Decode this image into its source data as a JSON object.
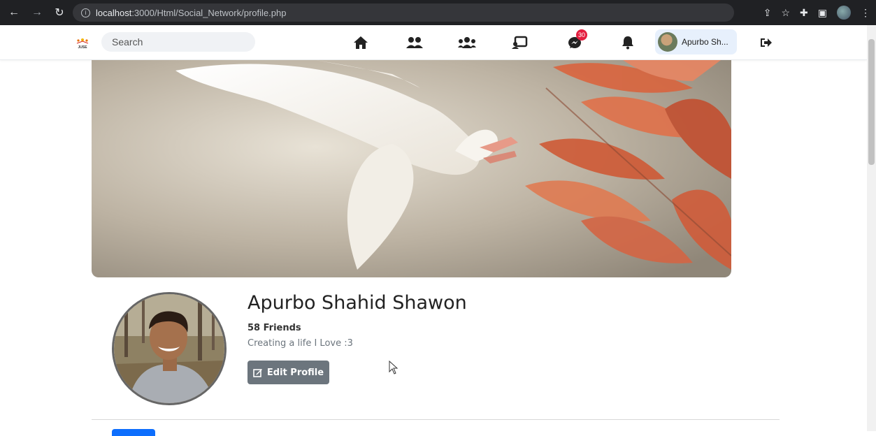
{
  "browser": {
    "url_host": "localhost",
    "url_rest": ":3000/Html/Social_Network/profile.php"
  },
  "nav": {
    "search_placeholder": "Search",
    "messenger_badge": "30",
    "user_short": "Apurbo Sh..."
  },
  "profile": {
    "name": "Apurbo Shahid Shawon",
    "friends": "58 Friends",
    "bio": "Creating a life I Love :3",
    "edit_label": "Edit Profile"
  },
  "colors": {
    "accent": "#0d6efd",
    "badge": "#e41e3f",
    "edit_button": "#6c757d"
  }
}
